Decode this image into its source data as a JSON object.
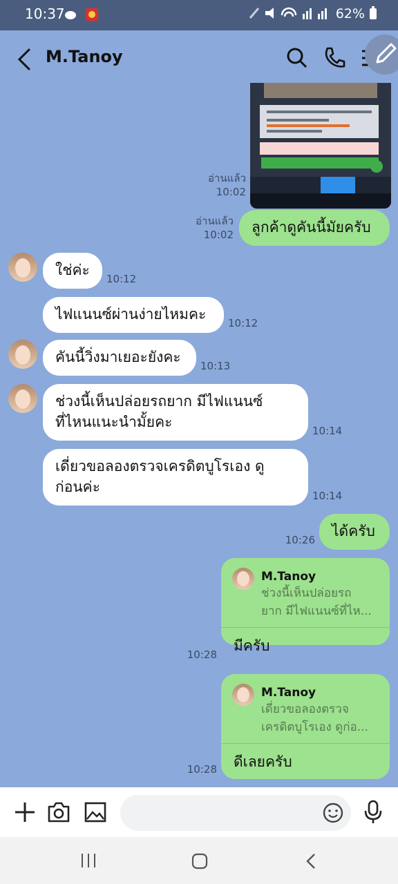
{
  "status_bar": {
    "time": "10:37",
    "battery": "62%"
  },
  "header": {
    "contact_name": "M.Tanoy"
  },
  "messages": [
    {
      "side": "out",
      "text": "ลูกค้าดูคันนี้มัยครับ",
      "read": "อ่านแล้ว",
      "time": "10:02"
    },
    {
      "side": "in",
      "text": "ใช่ค่ะ",
      "time": "10:12"
    },
    {
      "side": "in",
      "text": "ไฟแนนซ์ผ่านง่ายไหมคะ",
      "time": "10:12"
    },
    {
      "side": "in",
      "text": "คันนี้วิ่งมาเยอะยังคะ",
      "time": "10:13"
    },
    {
      "side": "in",
      "text_line1": "ช่วงนี้เห็นปล่อยรถยาก  มีไฟแนนซ์",
      "text_line2": "ที่ไหนแนะนำมั้ยคะ",
      "time": "10:14"
    },
    {
      "side": "in",
      "text_line1": "เดี่ยวขอลองตรวจเครดิตบูโรเอง ดู",
      "text_line2": "ก่อนค่ะ",
      "time": "10:14"
    },
    {
      "side": "out",
      "text": "ได้ครับ",
      "time": "10:26"
    }
  ],
  "preview_image": {
    "read": "อ่านแล้ว",
    "time": "10:02"
  },
  "replies": [
    {
      "quoted_name": "M.Tanoy",
      "quoted_line1": "ช่วงนี้เห็นปล่อยรถ",
      "quoted_line2": "ยาก  มีไฟแนนซ์ที่ไห...",
      "text": "มีครับ",
      "time": "10:28"
    },
    {
      "quoted_name": "M.Tanoy",
      "quoted_line1": "เดี่ยวขอลองตรวจ",
      "quoted_line2": "เครดิตบูโรเอง ดูก่อ...",
      "text": "ดีเลยครับ",
      "time": "10:28"
    }
  ],
  "colors": {
    "chat_bg": "#8ba9da",
    "outgoing": "#9de28e",
    "incoming": "#ffffff",
    "status_bar": "#4a5d7e"
  },
  "icons": [
    "back-arrow-icon",
    "search-icon",
    "phone-icon",
    "menu-icon",
    "pencil-icon",
    "plus-icon",
    "camera-icon",
    "image-icon",
    "emoji-icon",
    "mic-icon"
  ]
}
